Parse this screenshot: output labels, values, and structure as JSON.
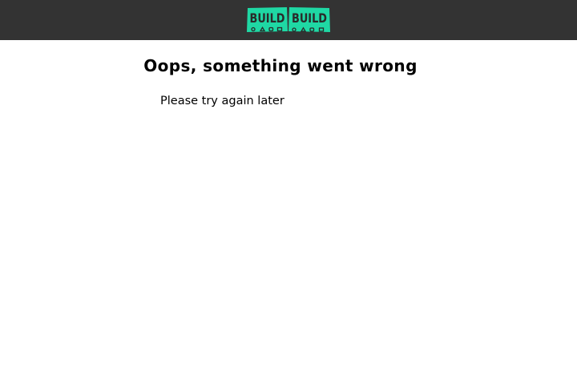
{
  "header": {
    "logo": {
      "text_left": "BUILD",
      "text_right": "BUILD",
      "icon": "buildbuild-logo-icon",
      "colors": {
        "brand": "#1fd8a4",
        "ink": "#2a2a2a"
      }
    },
    "background": "#333333"
  },
  "error": {
    "title": "Oops, something went wrong",
    "message": "Please try again later"
  }
}
